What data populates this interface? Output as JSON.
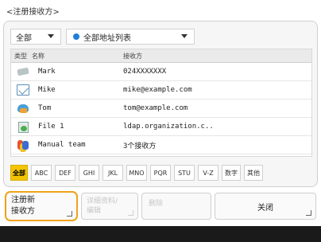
{
  "screen": {
    "title": "<注册接收方>"
  },
  "filters": {
    "scope_label": "全部",
    "list_label": "全部地址列表"
  },
  "table": {
    "headers": {
      "type": "类型",
      "name": "名称",
      "destination": "接收方"
    },
    "rows": [
      {
        "icon": "fax-icon",
        "name": "Mark",
        "destination": "024XXXXXXX"
      },
      {
        "icon": "email-icon",
        "name": "Mike",
        "destination": "mike@example.com"
      },
      {
        "icon": "shared-folder-icon",
        "name": "Tom",
        "destination": "tom@example.com"
      },
      {
        "icon": "ldap-file-icon",
        "name": "File 1",
        "destination": "ldap.organization.c.."
      },
      {
        "icon": "group-icon",
        "name": "Manual team",
        "destination": "3个接收方"
      }
    ]
  },
  "alpha_buttons": [
    "全部",
    "ABC",
    "DEF",
    "GHI",
    "JKL",
    "MNO",
    "PQR",
    "STU",
    "V-Z",
    "数字",
    "其他"
  ],
  "alpha_active_index": 0,
  "actions": {
    "register_line1": "注册新",
    "register_line2": "接收方",
    "edit_line1": "详细资料/",
    "edit_line2": "编辑",
    "delete_label": "删除",
    "close_label": "关闭"
  },
  "colors": {
    "accent": "#f2c500",
    "focus_border": "#f0a21b",
    "status_bar": "#1a1a1a"
  }
}
